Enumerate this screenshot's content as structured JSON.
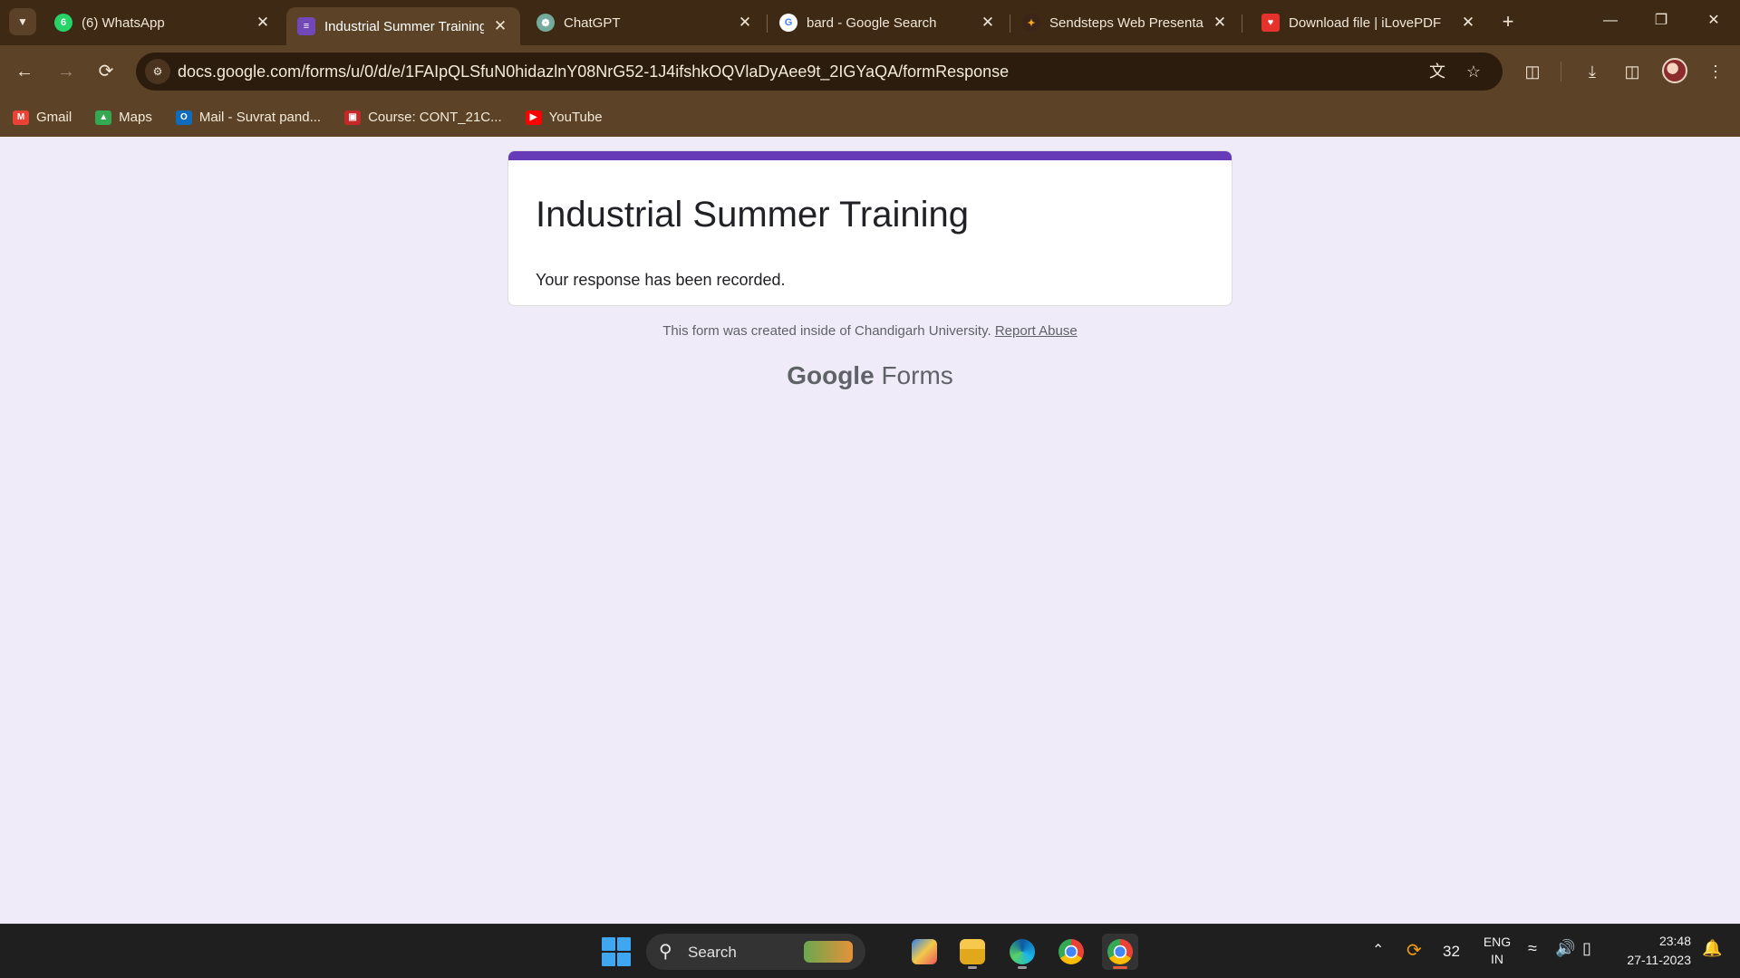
{
  "browser": {
    "tabs": [
      {
        "title": "(6) WhatsApp",
        "icon": "whatsapp-icon",
        "color": "#25d366",
        "badge": "6",
        "active": false
      },
      {
        "title": "Industrial Summer Training",
        "icon": "google-forms-icon",
        "color": "#7248b9",
        "active": true
      },
      {
        "title": "ChatGPT",
        "icon": "chatgpt-icon",
        "color": "#74aa9c",
        "active": false
      },
      {
        "title": "bard - Google Search",
        "icon": "google-icon",
        "color": "#ffffff",
        "active": false
      },
      {
        "title": "Sendsteps Web Presentation",
        "icon": "sendsteps-icon",
        "color": "#d35c26",
        "active": false
      },
      {
        "title": "Download file | iLovePDF",
        "icon": "ilovepdf-icon",
        "color": "#e5322d",
        "active": false
      }
    ],
    "url": "docs.google.com/forms/u/0/d/e/1FAIpQLSfuN0hidazlnY08NrG52-1J4ifshkOQVlaDyAee9t_2IGYaQA/formResponse",
    "bookmarks": [
      {
        "label": "Gmail",
        "icon": "gmail-icon",
        "color": "#ea4335"
      },
      {
        "label": "Maps",
        "icon": "maps-icon",
        "color": "#34a853"
      },
      {
        "label": "Mail - Suvrat pand...",
        "icon": "outlook-icon",
        "color": "#0f6cbd"
      },
      {
        "label": "Course: CONT_21C...",
        "icon": "course-icon",
        "color": "#c62828"
      },
      {
        "label": "YouTube",
        "icon": "youtube-icon",
        "color": "#ff0000"
      }
    ]
  },
  "form": {
    "title": "Industrial Summer Training",
    "message": "Your response has been recorded.",
    "accent_color": "#673ab7",
    "footer_note": "This form was created inside of Chandigarh University.",
    "report_link": "Report Abuse",
    "brand_google": "Google",
    "brand_forms": "Forms"
  },
  "taskbar": {
    "search_label": "Search",
    "temperature": "32",
    "language_top": "ENG",
    "language_bottom": "IN",
    "time": "23:48",
    "date": "27-11-2023"
  }
}
